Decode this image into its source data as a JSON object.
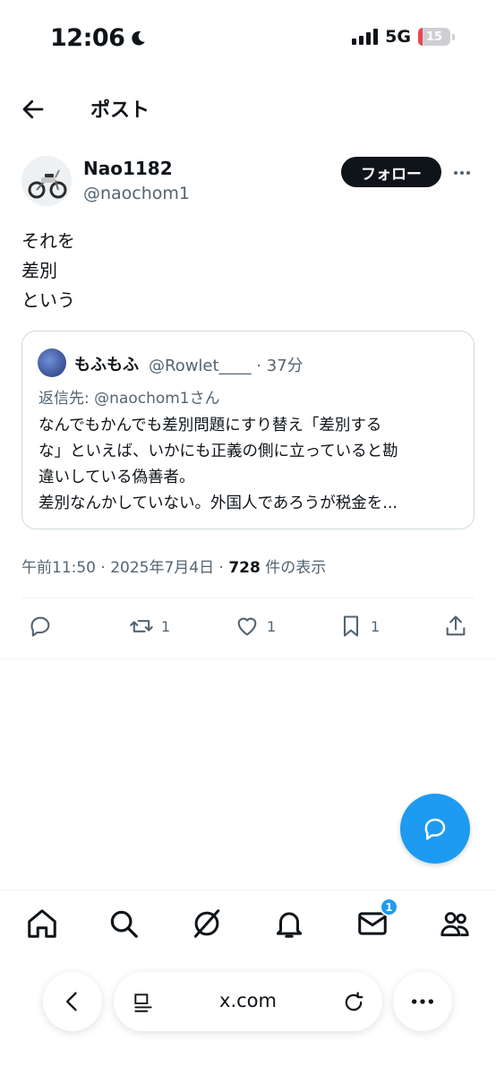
{
  "status_bar": {
    "time": "12:06",
    "network": "5G",
    "battery": "15",
    "battery_level": 0.15
  },
  "header": {
    "title": "ポスト"
  },
  "author": {
    "name": "Nao1182",
    "handle": "@naochom1",
    "follow_label": "フォロー"
  },
  "post": {
    "lines": [
      "それを",
      "差別",
      "という"
    ]
  },
  "quote": {
    "name": "もふもふ",
    "handle_time": "@Rowlet____ · 37分",
    "reply_to": "返信先: @naochom1さん",
    "lines": [
      "なんでもかんでも差別問題にすり替え「差別する",
      "な」といえば、いかにも正義の側に立っていると勘",
      "違いしている偽善者。",
      "差別なんかしていない。外国人であろうが税金を..."
    ]
  },
  "meta": {
    "time_date": "午前11:50 · 2025年7月4日 · ",
    "views": "728",
    "views_suffix": " 件の表示"
  },
  "actions": {
    "reply_count": "",
    "retweet_count": "1",
    "like_count": "1",
    "bookmark_count": "1"
  },
  "nav": {
    "messages_badge": "1"
  },
  "browser": {
    "url": "x.com"
  },
  "colors": {
    "accent": "#1d9bf0",
    "text": "#0f1419",
    "secondary": "#536471",
    "border": "#cfd9de"
  }
}
